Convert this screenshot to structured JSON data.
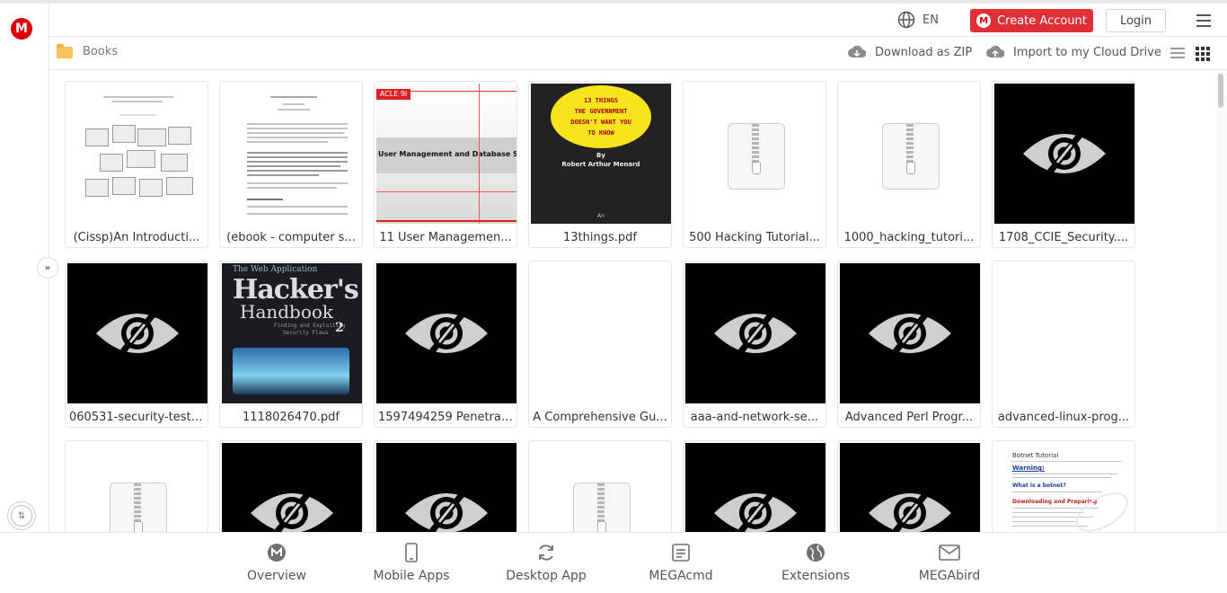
{
  "header": {
    "logo_letter": "M",
    "lang": "EN",
    "create_account": "Create Account",
    "login": "Login"
  },
  "breadcrumb": {
    "folder": "Books",
    "download_zip": "Download as ZIP",
    "import_cloud": "Import to my Cloud Drive"
  },
  "files": [
    {
      "name": "(Cissp)An Introducti...",
      "thumb": "doc-diagram"
    },
    {
      "name": "(ebook - computer s...",
      "thumb": "doc-text"
    },
    {
      "name": "11 User Managemen...",
      "thumb": "user-mgmt"
    },
    {
      "name": "13things.pdf",
      "thumb": "13things"
    },
    {
      "name": "500 Hacking Tutorial...",
      "thumb": "zip"
    },
    {
      "name": "1000_hacking_tutori...",
      "thumb": "zip"
    },
    {
      "name": "1708_CCIE_Security....",
      "thumb": "hidden"
    },
    {
      "name": "060531-security-testi...",
      "thumb": "hidden"
    },
    {
      "name": "1118026470.pdf",
      "thumb": "wahh"
    },
    {
      "name": "1597494259 Penetrat...",
      "thumb": "hidden"
    },
    {
      "name": "A Comprehensive Gu...",
      "thumb": "blank"
    },
    {
      "name": "aaa-and-network-se...",
      "thumb": "hidden"
    },
    {
      "name": "Advanced Perl Progr...",
      "thumb": "hidden"
    },
    {
      "name": "advanced-linux-prog...",
      "thumb": "blank"
    },
    {
      "name": "",
      "thumb": "zip"
    },
    {
      "name": "",
      "thumb": "hidden"
    },
    {
      "name": "",
      "thumb": "hidden"
    },
    {
      "name": "",
      "thumb": "zip"
    },
    {
      "name": "",
      "thumb": "hidden"
    },
    {
      "name": "",
      "thumb": "hidden"
    },
    {
      "name": "",
      "thumb": "botnet"
    }
  ],
  "thumbs": {
    "user_mgmt_title": "User Management and Database Security",
    "user_mgmt_tag": "ACLE 9i",
    "things_lines": [
      "13  THINGS",
      "THE  GOVERNMENT",
      "DOESN'T WANT YOU",
      "TO KNOW"
    ],
    "things_by": "By",
    "things_author": "Robert Arthur Menard",
    "things_footer": "An",
    "wahh_line1": "The Web Application",
    "wahh_line2": "Hacker's",
    "wahh_line3": "Handbook",
    "wahh_line4": "Finding and Exploiting",
    "wahh_line5": "Security Flaws",
    "wahh_edition": "2",
    "botnet_title": "Botnet Tutorial",
    "botnet_warning": "Warning:",
    "botnet_q": "What is a botnet?",
    "botnet_section": "Downloading and Preparing"
  },
  "bottom_nav": [
    {
      "label": "Overview",
      "icon": "mega-icon"
    },
    {
      "label": "Mobile Apps",
      "icon": "mobile-icon"
    },
    {
      "label": "Desktop App",
      "icon": "sync-icon"
    },
    {
      "label": "MEGAcmd",
      "icon": "terminal-icon"
    },
    {
      "label": "Extensions",
      "icon": "globe-icon"
    },
    {
      "label": "MEGAbird",
      "icon": "mail-icon"
    }
  ],
  "colors": {
    "brand_red": "#d90007",
    "create_button": "#e02f37"
  }
}
